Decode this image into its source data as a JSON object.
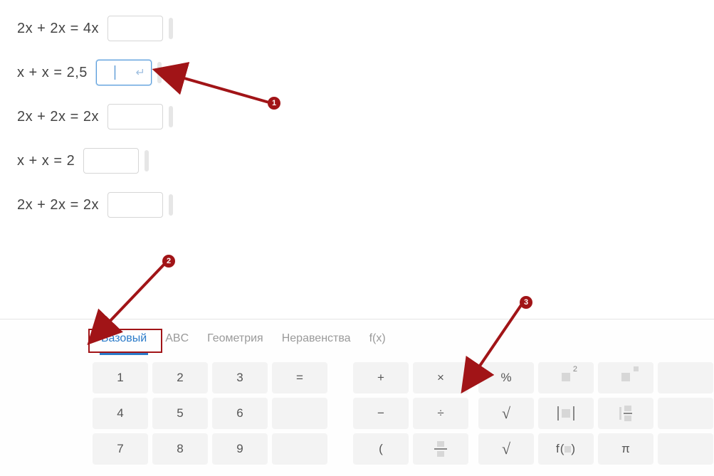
{
  "equations": [
    {
      "text": "2x + 2x = 4x",
      "focused": false
    },
    {
      "text": "x + x = 2,5",
      "focused": true
    },
    {
      "text": "2x + 2x = 2x",
      "focused": false
    },
    {
      "text": "x + x = 2",
      "focused": false
    },
    {
      "text": "2x + 2x = 2x",
      "focused": false
    }
  ],
  "annotations": {
    "badge1": "1",
    "badge2": "2",
    "badge3": "3"
  },
  "tabs": {
    "basic": "Базовый",
    "abc": "ABC",
    "geom": "Геометрия",
    "ineq": "Неравенства",
    "fx": "f(x)"
  },
  "keys": {
    "n1": "1",
    "n2": "2",
    "n3": "3",
    "eq": "=",
    "n4": "4",
    "n5": "5",
    "n6": "6",
    "n7": "7",
    "n8": "8",
    "n9": "9",
    "plus": "+",
    "times": "×",
    "minus": "−",
    "divide": "÷",
    "lparen": "(",
    "percent": "%",
    "root": "√",
    "rootn": "√",
    "fn": "f(   )",
    "pi": "π"
  }
}
